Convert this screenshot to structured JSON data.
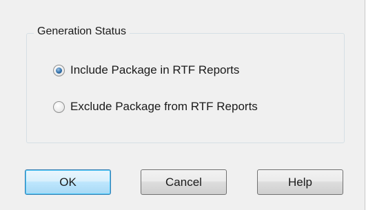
{
  "group": {
    "title": "Generation Status"
  },
  "options": [
    {
      "label": "Include Package in RTF Reports",
      "selected": true
    },
    {
      "label": "Exclude Package from RTF Reports",
      "selected": false
    }
  ],
  "buttons": {
    "ok": "OK",
    "cancel": "Cancel",
    "help": "Help"
  },
  "colors": {
    "dialog_background": "#f0f0f0",
    "default_button": "#bee6fd",
    "radio_selected": "#2f6ea8"
  }
}
